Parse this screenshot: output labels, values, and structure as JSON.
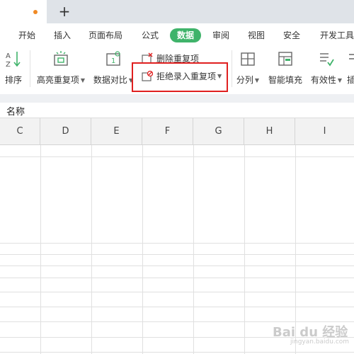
{
  "tabstrip": {
    "new_tab": "+"
  },
  "menu": {
    "tabs": [
      {
        "label": "开始"
      },
      {
        "label": "插入"
      },
      {
        "label": "页面布局"
      },
      {
        "label": "公式"
      },
      {
        "label": "数据"
      },
      {
        "label": "审阅"
      },
      {
        "label": "视图"
      },
      {
        "label": "安全"
      },
      {
        "label": "开发工具"
      }
    ],
    "active": "数据"
  },
  "toolbar": {
    "sort": "排序",
    "highlight_duplicates": "高亮重复项",
    "data_compare": "数据对比",
    "delete_duplicates": "删除重复项",
    "reject_duplicates": "拒绝录入重复项",
    "split_column": "分列",
    "smart_fill": "智能填充",
    "validity": "有效性",
    "overflow": "插"
  },
  "name_bar": {
    "value": "名称"
  },
  "grid": {
    "columns": [
      "C",
      "D",
      "E",
      "F",
      "G",
      "H",
      "I"
    ]
  },
  "watermark": {
    "text": "Bai du 经验",
    "sub": "jingyan.baidu.com"
  },
  "colors": {
    "accent": "#3fb36a",
    "highlight_box": "#e02020",
    "tab_dot": "#f08a24"
  }
}
